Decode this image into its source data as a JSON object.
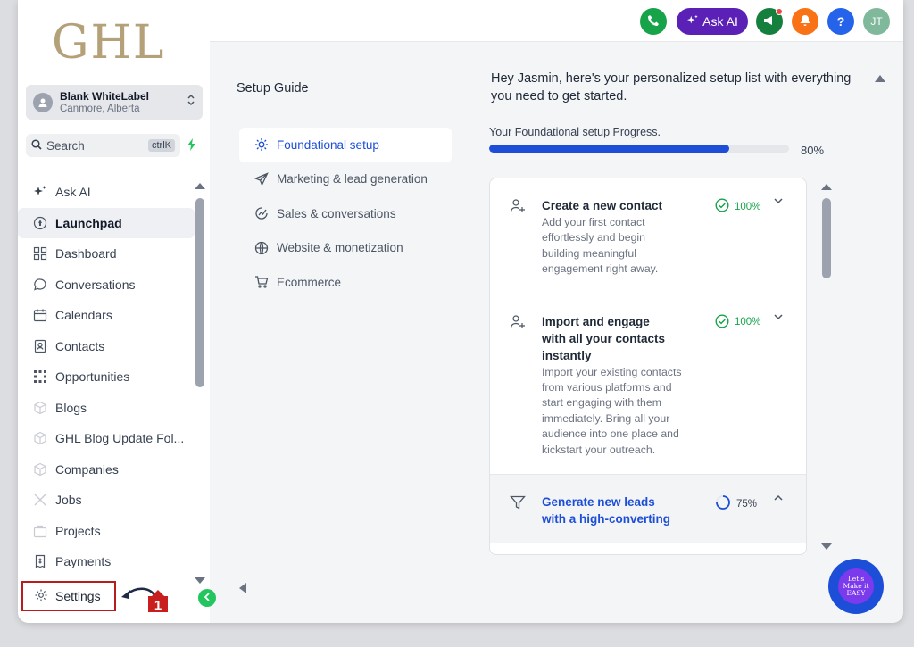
{
  "logo": "GHL",
  "account": {
    "name": "Blank WhiteLabel",
    "location": "Canmore, Alberta"
  },
  "search": {
    "label": "Search",
    "shortcut": "ctrlK"
  },
  "sidebar": {
    "items": [
      {
        "label": "Ask AI",
        "icon": "sparkle-icon"
      },
      {
        "label": "Launchpad",
        "icon": "rocket-icon",
        "active": true
      },
      {
        "label": "Dashboard",
        "icon": "grid-icon"
      },
      {
        "label": "Conversations",
        "icon": "chat-icon"
      },
      {
        "label": "Calendars",
        "icon": "calendar-icon"
      },
      {
        "label": "Contacts",
        "icon": "contact-card-icon"
      },
      {
        "label": "Opportunities",
        "icon": "opportunities-icon"
      },
      {
        "label": "Blogs",
        "icon": "cube-icon"
      },
      {
        "label": "GHL Blog Update Fol...",
        "icon": "cube-icon"
      },
      {
        "label": "Companies",
        "icon": "cube-icon"
      },
      {
        "label": "Jobs",
        "icon": "tools-icon"
      },
      {
        "label": "Projects",
        "icon": "briefcase-icon"
      },
      {
        "label": "Payments",
        "icon": "receipt-icon"
      }
    ],
    "settings_label": "Settings",
    "callout_number": "1"
  },
  "topbar": {
    "ask_ai_label": "Ask AI",
    "avatar_initials": "JT",
    "help_label": "?"
  },
  "setup": {
    "title": "Setup Guide",
    "items": [
      {
        "label": "Foundational setup",
        "icon": "sun-gear-icon",
        "active": true
      },
      {
        "label": "Marketing & lead generation",
        "icon": "send-icon"
      },
      {
        "label": "Sales & conversations",
        "icon": "chart-icon"
      },
      {
        "label": "Website & monetization",
        "icon": "globe-icon"
      },
      {
        "label": "Ecommerce",
        "icon": "cart-icon"
      }
    ],
    "greeting": "Hey Jasmin, here's your personalized setup list with everything you need to get started.",
    "progress_label": "Your Foundational setup Progress.",
    "progress_value": 80,
    "progress_text": "80%",
    "cards": [
      {
        "title": "Create a new contact",
        "desc": "Add your first contact effortlessly and begin building meaningful engagement right away.",
        "pct": "100%",
        "icon": "user-add-icon"
      },
      {
        "title": "Import and engage with all your contacts instantly",
        "desc": "Import your existing contacts from various platforms and start engaging with them immediately. Bring all your audience into one place and kickstart your outreach.",
        "pct": "100%",
        "icon": "user-add-icon"
      },
      {
        "title": "Generate new leads with a high-converting",
        "desc": "",
        "pct": "75%",
        "icon": "funnel-icon"
      }
    ]
  },
  "badge_text": "Let's Make it EASY",
  "colors": {
    "primary": "#1d4ed8",
    "success": "#16a34a",
    "purple": "#5b21b6",
    "annotation": "#b91c1c"
  }
}
